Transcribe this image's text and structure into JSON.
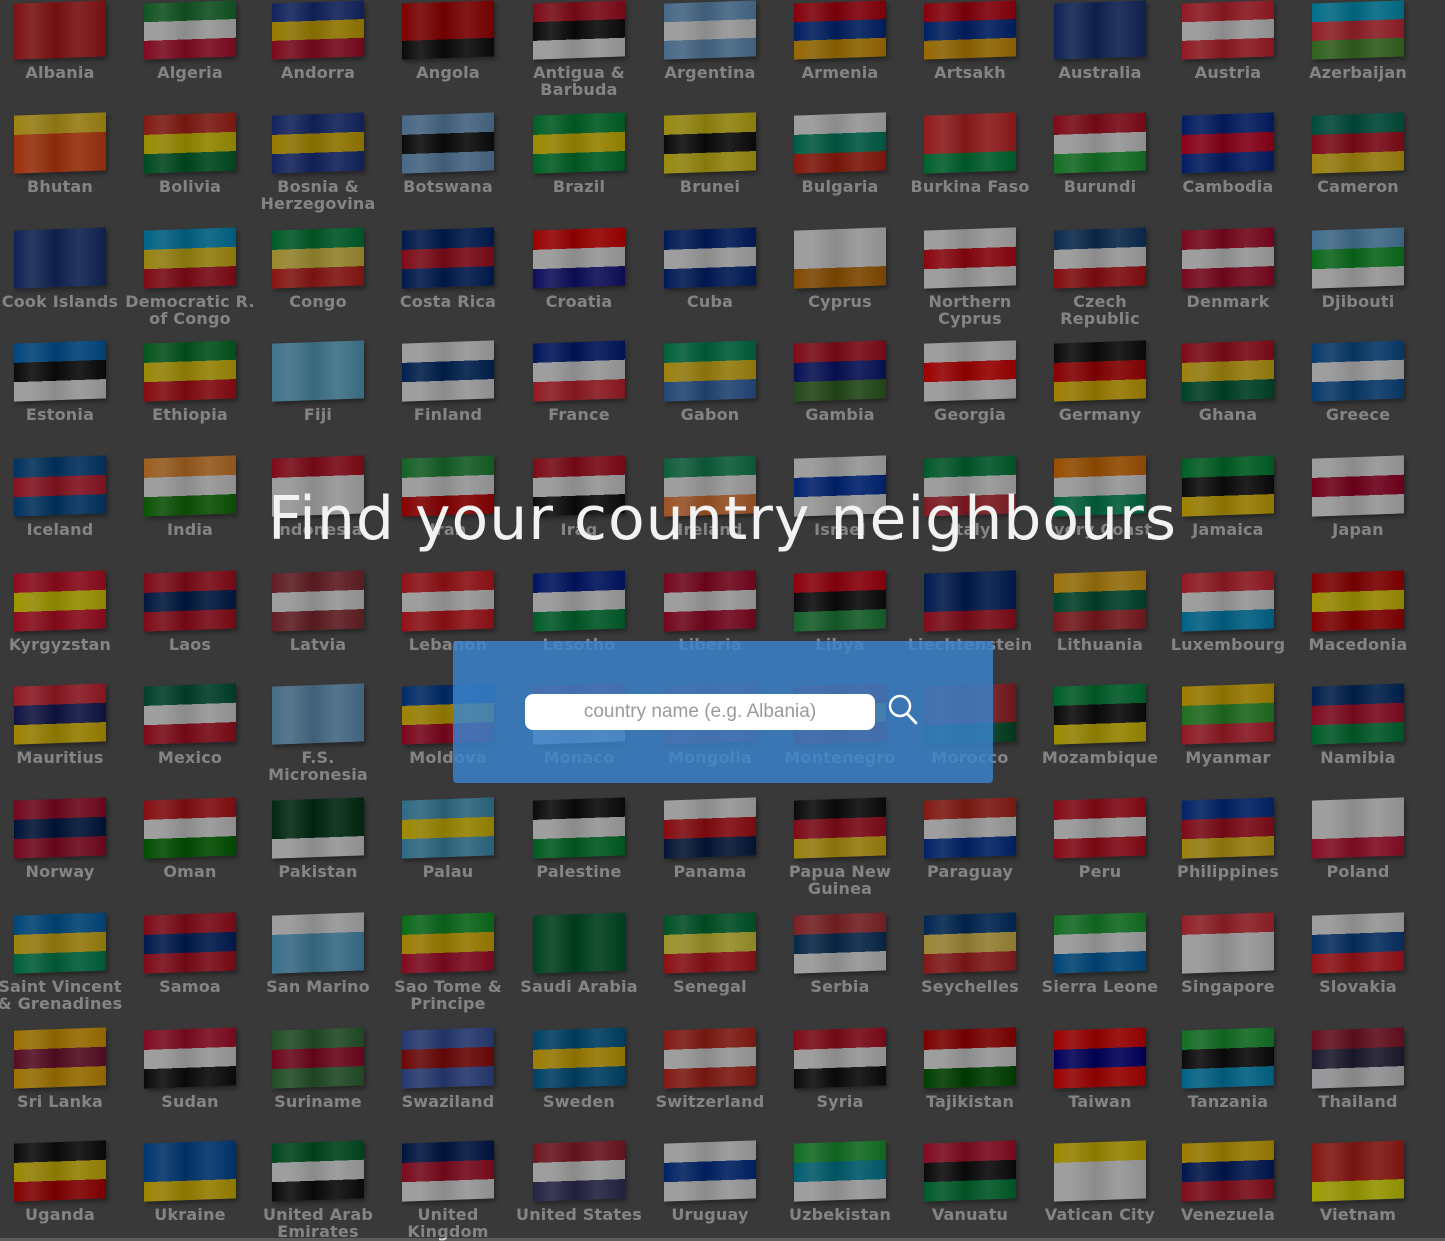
{
  "page": {
    "headline": "Find your country neighbours",
    "search": {
      "placeholder": "country name (e.g. Albania)",
      "value": ""
    }
  },
  "icons": {
    "search_button": "search-icon"
  },
  "colors": {
    "panel": "#3984ce",
    "overlay": "#000000",
    "headline": "#f2f2f2"
  },
  "rows": [
    [
      "Albania",
      "Algeria",
      "Andorra",
      "Angola",
      "Antigua & Barbuda",
      "Argentina",
      "Armenia",
      "Artsakh",
      "Australia",
      "Austria",
      "Azerbaijan"
    ],
    [
      "Bhutan",
      "Bolivia",
      "Bosnia & Herzegovina",
      "Botswana",
      "Brazil",
      "Brunei",
      "Bulgaria",
      "Burkina Faso",
      "Burundi",
      "Cambodia",
      "Cameron"
    ],
    [
      "Cook Islands",
      "Democratic R. of Congo",
      "Congo",
      "Costa Rica",
      "Croatia",
      "Cuba",
      "Cyprus",
      "Northern Cyprus",
      "Czech Republic",
      "Denmark",
      "Djibouti"
    ],
    [
      "Estonia",
      "Ethiopia",
      "Fiji",
      "Finland",
      "France",
      "Gabon",
      "Gambia",
      "Georgia",
      "Germany",
      "Ghana",
      "Greece"
    ],
    [
      "Iceland",
      "India",
      "Indonesia",
      "Iran",
      "Iraq",
      "Ireland",
      "Israel",
      "Italy",
      "Ivory Coast",
      "Jamaica",
      "Japan"
    ],
    [
      "Kyrgyzstan",
      "Laos",
      "Latvia",
      "Lebanon",
      "Lesotho",
      "Liberia",
      "Libya",
      "Liechtenstein",
      "Lithuania",
      "Luxembourg",
      "Macedonia"
    ],
    [
      "Mauritius",
      "Mexico",
      "F.S. Micronesia",
      "Moldova",
      "Monaco",
      "Mongolia",
      "Montenegro",
      "Morocco",
      "Mozambique",
      "Myanmar",
      "Namibia"
    ],
    [
      "Norway",
      "Oman",
      "Pakistan",
      "Palau",
      "Palestine",
      "Panama",
      "Papua New Guinea",
      "Paraguay",
      "Peru",
      "Philippines",
      "Poland"
    ],
    [
      "Saint Vincent & Grenadines",
      "Samoa",
      "San Marino",
      "Sao Tome & Principe",
      "Saudi Arabia",
      "Senegal",
      "Serbia",
      "Seychelles",
      "Sierra Leone",
      "Singapore",
      "Slovakia"
    ],
    [
      "Sri Lanka",
      "Sudan",
      "Suriname",
      "Swaziland",
      "Sweden",
      "Switzerland",
      "Syria",
      "Tajikistan",
      "Taiwan",
      "Tanzania",
      "Thailand"
    ],
    [
      "Uganda",
      "Ukraine",
      "United Arab Emirates",
      "United Kingdom",
      "United States",
      "Uruguay",
      "Uzbekistan",
      "Vanuatu",
      "Vatican City",
      "Venezuela",
      "Vietnam"
    ]
  ],
  "flag_colors": [
    [
      [
        "#d01c1f",
        "#d01c1f",
        "#d01c1f"
      ],
      [
        "#1c8a3a",
        "#ffffff",
        "#d21034"
      ],
      [
        "#1e3a9a",
        "#f2c500",
        "#c8102e"
      ],
      [
        "#cc0000",
        "#cc0000",
        "#111111"
      ],
      [
        "#ce1126",
        "#111111",
        "#ffffff"
      ],
      [
        "#74acdf",
        "#ffffff",
        "#74acdf"
      ],
      [
        "#d90012",
        "#0033a0",
        "#f2a800"
      ],
      [
        "#d90012",
        "#0033a0",
        "#f2a800"
      ],
      [
        "#1a3a8a",
        "#1a3a8a",
        "#1a3a8a"
      ],
      [
        "#ed2939",
        "#ffffff",
        "#ed2939"
      ],
      [
        "#00b5e2",
        "#ef3340",
        "#509e2f"
      ]
    ],
    [
      [
        "#ffd520",
        "#ff4e12",
        "#ff4e12"
      ],
      [
        "#d52b1e",
        "#f9e300",
        "#007934"
      ],
      [
        "#1e3a9a",
        "#f2c500",
        "#1e3a9a"
      ],
      [
        "#75aadb",
        "#111111",
        "#75aadb"
      ],
      [
        "#009c3b",
        "#ffdf00",
        "#009c3b"
      ],
      [
        "#f7e017",
        "#111111",
        "#f7e017"
      ],
      [
        "#ffffff",
        "#00966e",
        "#d62612"
      ],
      [
        "#ef2b2d",
        "#ef2b2d",
        "#009e49"
      ],
      [
        "#ce1126",
        "#ffffff",
        "#1eb53a"
      ],
      [
        "#032ea1",
        "#e00025",
        "#032ea1"
      ],
      [
        "#007a5e",
        "#ce1126",
        "#fcd116"
      ]
    ],
    [
      [
        "#1a3a8a",
        "#1a3a8a",
        "#1a3a8a"
      ],
      [
        "#00a3dd",
        "#f7d618",
        "#ce1021"
      ],
      [
        "#009543",
        "#fbde4a",
        "#dc241f"
      ],
      [
        "#002b7f",
        "#ce1126",
        "#002b7f"
      ],
      [
        "#ff0000",
        "#ffffff",
        "#171796"
      ],
      [
        "#002a8f",
        "#ffffff",
        "#002a8f"
      ],
      [
        "#ffffff",
        "#ffffff",
        "#d57800"
      ],
      [
        "#ffffff",
        "#e30a17",
        "#ffffff"
      ],
      [
        "#11457e",
        "#ffffff",
        "#d7141a"
      ],
      [
        "#c60c30",
        "#ffffff",
        "#c60c30"
      ],
      [
        "#6ab2e7",
        "#12ad2b",
        "#ffffff"
      ]
    ],
    [
      [
        "#0072ce",
        "#111111",
        "#ffffff"
      ],
      [
        "#078930",
        "#fcdd09",
        "#da121a"
      ],
      [
        "#68bfe5",
        "#68bfe5",
        "#68bfe5"
      ],
      [
        "#ffffff",
        "#003580",
        "#ffffff"
      ],
      [
        "#002395",
        "#ffffff",
        "#ed2939"
      ],
      [
        "#009e60",
        "#fcd116",
        "#3a75c4"
      ],
      [
        "#ce1126",
        "#0c1c8c",
        "#3a7728"
      ],
      [
        "#ffffff",
        "#ff0000",
        "#ffffff"
      ],
      [
        "#111111",
        "#dd0000",
        "#ffce00"
      ],
      [
        "#ce1126",
        "#fcd116",
        "#006b3f"
      ],
      [
        "#0d5eaf",
        "#ffffff",
        "#0d5eaf"
      ]
    ],
    [
      [
        "#02529c",
        "#dc1e35",
        "#02529c"
      ],
      [
        "#ff9933",
        "#ffffff",
        "#138808"
      ],
      [
        "#ce1126",
        "#ffffff",
        "#ffffff"
      ],
      [
        "#239f40",
        "#ffffff",
        "#da0000"
      ],
      [
        "#ce1126",
        "#ffffff",
        "#111111"
      ],
      [
        "#169b62",
        "#ffffff",
        "#ff883e"
      ],
      [
        "#ffffff",
        "#0038b8",
        "#ffffff"
      ],
      [
        "#009246",
        "#ffffff",
        "#ce2b37"
      ],
      [
        "#f77f00",
        "#ffffff",
        "#009e60"
      ],
      [
        "#009b3a",
        "#111111",
        "#fed100"
      ],
      [
        "#ffffff",
        "#bc002d",
        "#ffffff"
      ]
    ],
    [
      [
        "#e8112d",
        "#ffef00",
        "#e8112d"
      ],
      [
        "#ce1126",
        "#002868",
        "#ce1126"
      ],
      [
        "#9e3039",
        "#ffffff",
        "#9e3039"
      ],
      [
        "#ed1c24",
        "#ffffff",
        "#ed1c24"
      ],
      [
        "#00209f",
        "#ffffff",
        "#009543"
      ],
      [
        "#bf0a30",
        "#ffffff",
        "#bf0a30"
      ],
      [
        "#e70013",
        "#111111",
        "#239e46"
      ],
      [
        "#002b7f",
        "#002b7f",
        "#ce1126"
      ],
      [
        "#fdb913",
        "#006a44",
        "#c1272d"
      ],
      [
        "#ed2939",
        "#ffffff",
        "#00a1de"
      ],
      [
        "#d20000",
        "#ffe600",
        "#d20000"
      ]
    ],
    [
      [
        "#ea2839",
        "#1a206d",
        "#ffd500"
      ],
      [
        "#006847",
        "#ffffff",
        "#ce1126"
      ],
      [
        "#75b2dd",
        "#75b2dd",
        "#75b2dd"
      ],
      [
        "#0046ae",
        "#ffd200",
        "#cc092f"
      ],
      [
        "#ce1126",
        "#ce1126",
        "#ffffff"
      ],
      [
        "#c4272f",
        "#015197",
        "#c4272f"
      ],
      [
        "#c40308",
        "#d3ae3b",
        "#c40308"
      ],
      [
        "#c1272d",
        "#c1272d",
        "#006233"
      ],
      [
        "#009a44",
        "#111111",
        "#fce100"
      ],
      [
        "#fecb00",
        "#34b233",
        "#ea2839"
      ],
      [
        "#003580",
        "#d21034",
        "#009543"
      ]
    ],
    [
      [
        "#ba0c2f",
        "#00205b",
        "#ba0c2f"
      ],
      [
        "#db161b",
        "#ffffff",
        "#008000"
      ],
      [
        "#01411c",
        "#01411c",
        "#ffffff"
      ],
      [
        "#4aadd6",
        "#ffde00",
        "#4aadd6"
      ],
      [
        "#111111",
        "#ffffff",
        "#009736"
      ],
      [
        "#ffffff",
        "#da121a",
        "#072357"
      ],
      [
        "#111111",
        "#ce1126",
        "#fcd116"
      ],
      [
        "#d52b1e",
        "#ffffff",
        "#0038a8"
      ],
      [
        "#d91023",
        "#ffffff",
        "#d91023"
      ],
      [
        "#0038a8",
        "#ce1126",
        "#fcd116"
      ],
      [
        "#ffffff",
        "#ffffff",
        "#dc143c"
      ]
    ],
    [
      [
        "#0072c6",
        "#fcd116",
        "#009e60"
      ],
      [
        "#ce1126",
        "#002b7f",
        "#ce1126"
      ],
      [
        "#ffffff",
        "#5eb6e4",
        "#5eb6e4"
      ],
      [
        "#12ad2b",
        "#ffce00",
        "#d21034"
      ],
      [
        "#006c35",
        "#006c35",
        "#006c35"
      ],
      [
        "#00853f",
        "#fdef42",
        "#e31b23"
      ],
      [
        "#c6363c",
        "#0c4076",
        "#ffffff"
      ],
      [
        "#003f87",
        "#fcd856",
        "#d62828"
      ],
      [
        "#1eb53a",
        "#ffffff",
        "#0072c6"
      ],
      [
        "#ef3340",
        "#ffffff",
        "#ffffff"
      ],
      [
        "#ffffff",
        "#0b4ea2",
        "#ee1c25"
      ]
    ],
    [
      [
        "#ffb700",
        "#8d153a",
        "#ffb700"
      ],
      [
        "#d21034",
        "#ffffff",
        "#111111"
      ],
      [
        "#377e3f",
        "#b40a2d",
        "#377e3f"
      ],
      [
        "#3e5eb9",
        "#b10c0c",
        "#3e5eb9"
      ],
      [
        "#006aa7",
        "#fecc00",
        "#006aa7"
      ],
      [
        "#d52b1e",
        "#ffffff",
        "#d52b1e"
      ],
      [
        "#ce1126",
        "#ffffff",
        "#111111"
      ],
      [
        "#cc0000",
        "#ffffff",
        "#006600"
      ],
      [
        "#fe0000",
        "#000095",
        "#fe0000"
      ],
      [
        "#1eb53a",
        "#111111",
        "#00a3dd"
      ],
      [
        "#a51931",
        "#2d2a4a",
        "#f4f5f8"
      ]
    ],
    [
      [
        "#111111",
        "#fcdc04",
        "#d90000"
      ],
      [
        "#0057b7",
        "#0057b7",
        "#ffd700"
      ],
      [
        "#00732f",
        "#ffffff",
        "#111111"
      ],
      [
        "#012169",
        "#c8102e",
        "#ffffff"
      ],
      [
        "#b22234",
        "#ffffff",
        "#3c3b6e"
      ],
      [
        "#ffffff",
        "#0038a8",
        "#ffffff"
      ],
      [
        "#1eb53a",
        "#0099b5",
        "#ffffff"
      ],
      [
        "#d21034",
        "#111111",
        "#009543"
      ],
      [
        "#ffe000",
        "#ffffff",
        "#ffffff"
      ],
      [
        "#ffcc00",
        "#00247d",
        "#cf142b"
      ],
      [
        "#da251d",
        "#da251d",
        "#ffff00"
      ]
    ]
  ]
}
